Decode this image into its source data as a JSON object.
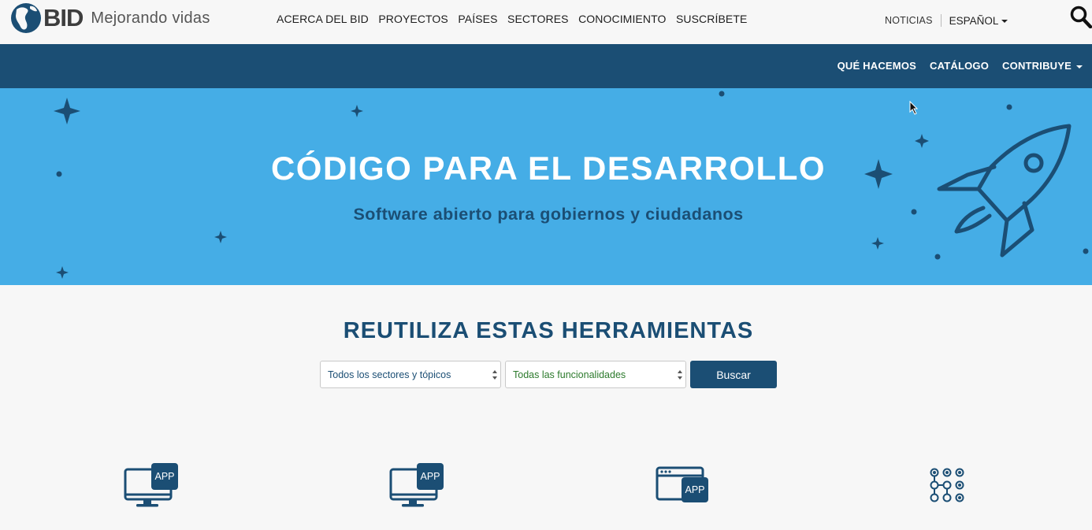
{
  "header": {
    "logo_text": "BID",
    "tagline": "Mejorando vidas",
    "nav": [
      "ACERCA DEL BID",
      "PROYECTOS",
      "PAÍSES",
      "SECTORES",
      "CONOCIMIENTO",
      "SUSCRÍBETE"
    ],
    "news": "NOTICIAS",
    "language": "ESPAÑOL"
  },
  "subnav": {
    "items": [
      "QUÉ HACEMOS",
      "CATÁLOGO",
      "CONTRIBUYE"
    ]
  },
  "hero": {
    "title": "CÓDIGO PARA EL DESARROLLO",
    "subtitle": "Software abierto para gobiernos y ciudadanos"
  },
  "tools": {
    "title": "REUTILIZA ESTAS HERRAMIENTAS",
    "sectors_select": "Todos los sectores y tópicos",
    "functions_select": "Todas las funcionalidades",
    "search_button": "Buscar",
    "app_badge": "APP"
  },
  "colors": {
    "navy": "#1b4e74",
    "hero_blue": "#45ade6",
    "accent_orange": "#e04a1f"
  }
}
